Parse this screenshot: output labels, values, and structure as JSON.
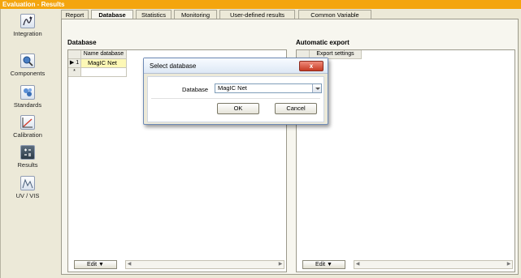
{
  "window": {
    "title": "Evaluation - Results"
  },
  "sidebar": {
    "items": [
      {
        "label": "Integration",
        "icon": "integration-icon"
      },
      {
        "label": "Components",
        "icon": "components-icon"
      },
      {
        "label": "Standards",
        "icon": "standards-icon"
      },
      {
        "label": "Calibration",
        "icon": "calibration-icon"
      },
      {
        "label": "Results",
        "icon": "results-icon"
      },
      {
        "label": "UV / VIS",
        "icon": "uv-vis-icon"
      }
    ]
  },
  "tabs": [
    {
      "label": "Report"
    },
    {
      "label": "Database"
    },
    {
      "label": "Statistics"
    },
    {
      "label": "Monitoring"
    },
    {
      "label": "User-defined results"
    },
    {
      "label": "Common Variable"
    }
  ],
  "active_tab": "Database",
  "database_section": {
    "title": "Database",
    "column_header": "Name database",
    "rows": [
      {
        "marker": "▶ 1",
        "name": "MagIC Net"
      },
      {
        "marker": "*",
        "name": ""
      }
    ],
    "edit_label": "Edit ▼"
  },
  "export_section": {
    "title": "Automatic export",
    "column_header": "Export settings",
    "edit_label": "Edit ▼"
  },
  "dialog": {
    "title": "Select database",
    "close_label": "x",
    "field_label": "Database",
    "field_value": "MagIC Net",
    "ok_label": "OK",
    "cancel_label": "Cancel"
  },
  "colors": {
    "title_bar": "#f4a50e",
    "selected_cell": "#fdf8b6",
    "close_button": "#c73b25"
  }
}
